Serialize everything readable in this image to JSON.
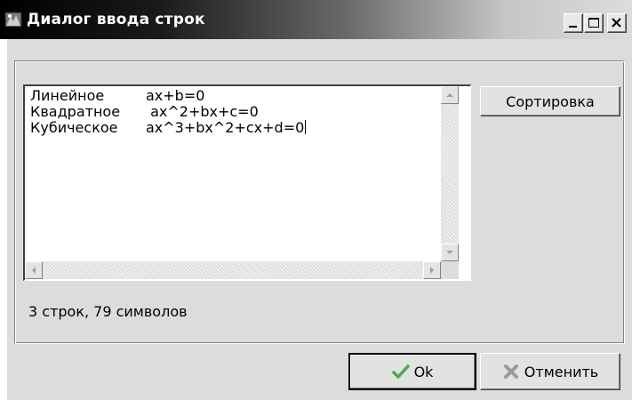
{
  "window": {
    "title": "Диалог ввода строк",
    "controls": {
      "minimize": "minimize-icon",
      "maximize": "maximize-icon",
      "close": "close-icon"
    }
  },
  "memo": {
    "lines": [
      {
        "name": "Линейное",
        "formula": "ax+b=0"
      },
      {
        "name": "Квадратное",
        "formula": " ax^2+bx+c=0"
      },
      {
        "name": "Кубическое",
        "formula": "ax^3+bx^2+cx+d=0"
      }
    ]
  },
  "buttons": {
    "sort": "Сортировка",
    "ok": "Ok",
    "cancel": "Отменить"
  },
  "status": "3 строк, 79 символов",
  "colors": {
    "title_start": "#000000",
    "title_end": "#dcdcdc",
    "face": "#dcdcdc",
    "ok_check": "#4fa84a",
    "cancel_x": "#9a9a9a"
  }
}
